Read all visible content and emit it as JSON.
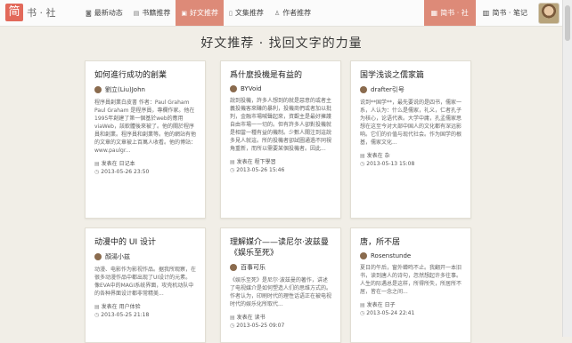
{
  "brand": {
    "mark": "简",
    "name": "书 · 社"
  },
  "nav": {
    "links": [
      {
        "icon": "rss-icon",
        "glyph": "◙",
        "label": "最新动态"
      },
      {
        "icon": "book-icon",
        "glyph": "▤",
        "label": "书籍推荐"
      },
      {
        "icon": "document-icon",
        "glyph": "▣",
        "label": "好文推荐"
      },
      {
        "icon": "file-icon",
        "glyph": "▯",
        "label": "文集推荐"
      },
      {
        "icon": "user-icon",
        "glyph": "♙",
        "label": "作者推荐"
      }
    ],
    "right": [
      {
        "icon": "gift-icon",
        "glyph": "▦",
        "label": "简书 · 社"
      },
      {
        "icon": "notebook-icon",
        "glyph": "▥",
        "label": "简书 · 笔记"
      }
    ]
  },
  "page": {
    "heading": "好文推荐 · 找回文字的力量"
  },
  "cards": [
    {
      "title": "如何進行成功的創業",
      "author": "劉立(Liu)John",
      "excerpt": "程序員創業白皮書 作者：Paul Graham Paul Graham 是程序員，專欄作家。他在1995年創建了第一個基於web的應用viaWeb，該軟體後來被了。他的關於程序員和創業。程序員和創業等。他的網站有他的文章的文章被上百萬人收看。他的博站：www.paulgr...",
      "collection": "发表在 日记本",
      "date": "2013-05-26 23:50"
    },
    {
      "title": "爲什麼投機是有益的",
      "author": "BYVoid",
      "excerpt": "說到投機，許多人想到的就是惡意的或者主義投機客來賺的暴利，投機商們或者加以批判，金融市場喊聲起來，資觀主是最好擁護自由市場一一切的。但有許多人卻對投機就是相當一種有益的機制。少數人關注到這說多見人就這。所的投機者卻試圖通過不同視角重新，而所以需要某個投機者。因此...",
      "collection": "发表在 程下學習",
      "date": "2013-05-26 15:46"
    },
    {
      "title": "国学浅谈之儒家篇",
      "author": "drafter引号",
      "excerpt": "说到**国学**，最先要说的是四书，儒家一系，人认为：什么是儒家，礼义，仁者孔子为核心，论语代表。大学中庸，孔孟儒家思想在这至今对大部中国人的文化都有深远影响。它们的价值与现代社会。作为国学的根基，儒家文化...",
      "collection": "发表在 杂",
      "date": "2013-05-13 15:08"
    },
    {
      "title": "动漫中的 UI 设计",
      "author": "顏湯小兹",
      "excerpt": "动漫、电影作为影视作品。据我所观察，在很多动漫作品中都出现了UI设计的元素。像EVA中的MAGI系统界面，攻壳机动队中的各种界面设计都非常精美...",
      "collection": "发表在 用户体验",
      "date": "2013-05-25 21:18"
    },
    {
      "title": "理解媒介——读尼尔·波兹曼《娱乐至死》",
      "author": "百事可乐",
      "excerpt": "《娱乐至死》是尼尔·波兹曼的著作，讲述了电视媒介是如何塑造人们的思维方式的。作者认为，印刷时代的理性话语正在被电视时代的娱乐化所取代...",
      "collection": "发表在 读书",
      "date": "2013-05-25 09:07"
    },
    {
      "title": "唐，所不居",
      "author": "Rosenstunde",
      "excerpt": "夏日的午后，窗外蝉鸣不止。我翻开一本旧书，读到唐人的诗句，忽然想起许多往事。人生的际遇总是这样，所得所失，所居所不居，皆在一念之间...",
      "collection": "发表在 日子",
      "date": "2013-05-24 22:41"
    }
  ]
}
